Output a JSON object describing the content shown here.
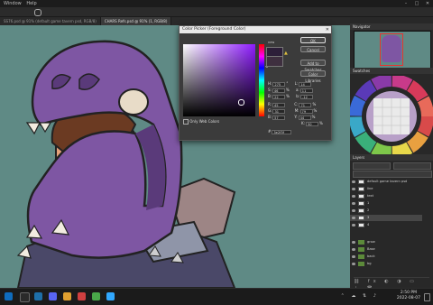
{
  "menubar": {
    "items": [
      "Window",
      "Help"
    ]
  },
  "tabs": [
    {
      "label": "SS76.psd @ 91% (default game tavern psd, RGB/8)",
      "active": false
    },
    {
      "label": "CHARS Refs.psd @ 91% (1, RGB/8)",
      "active": true
    }
  ],
  "color_picker": {
    "title": "Color Picker (Foreground Color)",
    "new_label": "new",
    "ok": "OK",
    "cancel": "Cancel",
    "add_swatches": "Add to Swatches",
    "color_libraries": "Color Libraries",
    "only_web_colors": "Only Web Colors",
    "hex": "3e2f3f",
    "fields": [
      {
        "label": "H:",
        "value": "275",
        "unit": "°",
        "label2": "L:",
        "value2": "14"
      },
      {
        "label": "S:",
        "value": "46",
        "unit": "%",
        "label2": "a:",
        "value2": "11"
      },
      {
        "label": "B:",
        "value": "22",
        "unit": "%",
        "label2": "b:",
        "value2": "-12"
      },
      {
        "label": "R:",
        "value": "45",
        "unit": "",
        "label2": "C:",
        "value2": "71"
      },
      {
        "label": "G:",
        "value": "31",
        "unit": "",
        "label2": "M:",
        "value2": "79"
      },
      {
        "label": "B:",
        "value": "57",
        "unit": "",
        "label2": "Y:",
        "value2": "44"
      },
      {
        "label": "",
        "value": "",
        "unit": "",
        "label2": "K:",
        "value2": "50"
      }
    ],
    "new_color": "#2d1f39",
    "current_color": "#3e2f3f"
  },
  "panels": {
    "navigator": "Navigator",
    "swatches": "Swatches",
    "layers": "Layers"
  },
  "layers": [
    {
      "name": "default game tavern psd",
      "type": "layer"
    },
    {
      "name": "line",
      "type": "layer"
    },
    {
      "name": "text",
      "type": "layer"
    },
    {
      "name": "1",
      "type": "layer"
    },
    {
      "name": "2",
      "type": "layer"
    },
    {
      "name": "3",
      "type": "layer"
    },
    {
      "name": "4",
      "type": "layer"
    },
    {
      "name": "grow",
      "type": "folder"
    },
    {
      "name": "Base",
      "type": "folder"
    },
    {
      "name": "back",
      "type": "folder"
    },
    {
      "name": "bg",
      "type": "folder"
    }
  ],
  "clock": {
    "time": "2:50 PM",
    "date": "2022-08-07"
  },
  "colors": {
    "canvas_bg": "#5f8a85",
    "hood": "#7e56a3",
    "hood_dark": "#5a3a7a",
    "skin": "#e6a27a",
    "hair": "#6b3a22"
  }
}
